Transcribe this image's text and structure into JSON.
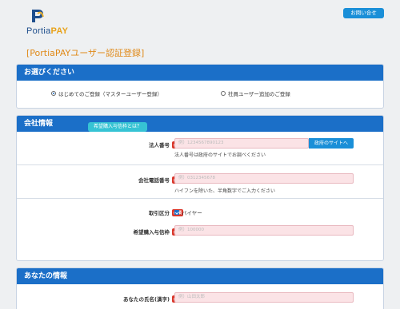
{
  "brand": {
    "portia": "Portia",
    "pay": "PAY"
  },
  "header": {
    "contact_label": "お問い合せ"
  },
  "page": {
    "title": "[PortiaPAYユーザー認証登録]"
  },
  "choose_section": {
    "title": "お選びください",
    "options": [
      {
        "label": "はじめてのご登録（マスターユーザー登録）",
        "selected": true
      },
      {
        "label": "社員ユーザー追加のご登録",
        "selected": false
      }
    ]
  },
  "company_section": {
    "title": "会社情報",
    "required_badge": "必須",
    "corporate_number": {
      "label": "法人番号",
      "placeholder": "例）1234567890123",
      "button": "政府のサイトへ",
      "help": "法人番号は政府のサイトでお調べください"
    },
    "company_phone": {
      "label": "会社電話番号",
      "placeholder": "例）0312345678",
      "help": "ハイフンを除いた、半角数字でご入力ください"
    },
    "trade_category": {
      "label": "取引区分",
      "option": "バイヤー",
      "checked": true
    },
    "desired_credit": {
      "label": "希望購入与信枠",
      "placeholder": "例）100000",
      "info_button": "希望購入与信枠とは？"
    }
  },
  "you_section": {
    "title": "あなたの情報",
    "full_name": {
      "label": "あなたの氏名(漢字)",
      "placeholder": "例）山田太郎"
    }
  },
  "colors": {
    "header_blue": "#1b6fc8",
    "accent_orange": "#e08a1a",
    "required_red": "#d9382c",
    "input_pink": "#fbe3e6",
    "button_blue": "#1a8fd8",
    "teal": "#36c3d4"
  }
}
